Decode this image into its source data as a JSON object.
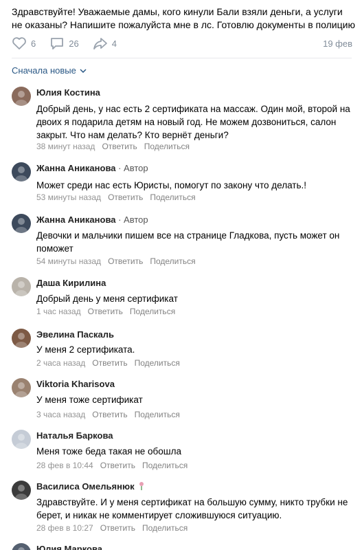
{
  "post": {
    "text": "Здравствуйте! Уважаемые дамы, кого кинули Бали взяли деньги, а услуги не оказаны? Напишите пожалуйста мне в лс. Готовлю документы в полицию",
    "likes": "6",
    "comments": "26",
    "shares": "4",
    "date": "19 фев"
  },
  "sort_label": "Сначала новые",
  "reply_label": "Ответить",
  "share_label": "Поделиться",
  "comments": [
    {
      "name": "Юлия Костина",
      "badge": "",
      "text": "Добрый день, у нас есть 2 сертификата на массаж. Один мой, второй на двоих я подарила детям на новый год. Не можем дозвониться, салон закрыт. Что нам делать? Кто вернёт деньги?",
      "time": "38 минут назад",
      "avatar_color": "#8a6b5c"
    },
    {
      "name": "Жанна Аниканова",
      "badge": " · Автор",
      "text": "Может среди нас есть Юристы, помогут по закону что делать.!",
      "time": "53 минуты назад",
      "avatar_color": "#3d4a5c"
    },
    {
      "name": "Жанна Аниканова",
      "badge": " · Автор",
      "text": "Девочки и мальчики пишем все на странице Гладкова, пусть может он поможет",
      "time": "54 минуты назад",
      "avatar_color": "#3d4a5c"
    },
    {
      "name": "Даша Кирилина",
      "badge": "",
      "text": "Добрый день у меня сертификат",
      "time": "1 час назад",
      "avatar_color": "#b9b3aa"
    },
    {
      "name": "Эвелина Паскаль",
      "badge": "",
      "text": "У меня 2 сертификата.",
      "time": "2 часа назад",
      "avatar_color": "#7d5a45"
    },
    {
      "name": "Viktoria Kharisova",
      "badge": "",
      "text": "У меня тоже сертификат",
      "time": "3 часа назад",
      "avatar_color": "#9a8270"
    },
    {
      "name": "Наталья Баркова",
      "badge": "",
      "text": "Меня тоже беда такая не обошла",
      "time": "28 фев в 10:44",
      "avatar_color": "#c5ccd6"
    },
    {
      "name": "Василиса Омельянюк",
      "badge": "",
      "text": "Здравствуйте. И у меня сертификат на большую сумму, никто трубки не берет, и никак не комментирует сложившуюся ситуацию.",
      "time": "28 фев в 10:27",
      "avatar_color": "#3b3b3b"
    },
    {
      "name": "Юлия Маркова",
      "badge": "",
      "text": "",
      "time": "",
      "avatar_color": "#556070"
    }
  ]
}
